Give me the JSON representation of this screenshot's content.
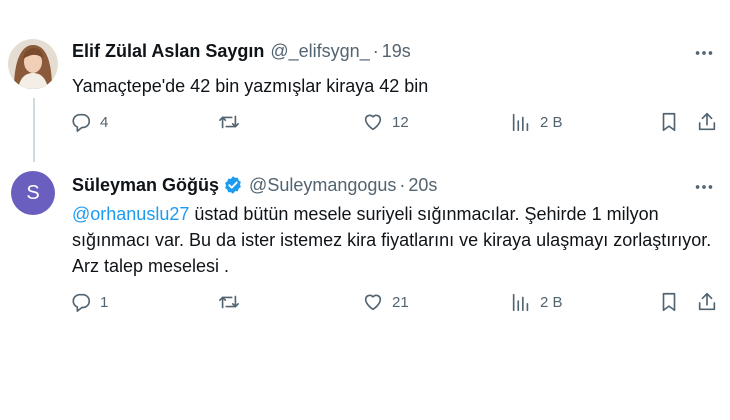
{
  "tweets": [
    {
      "display_name": "Elif Zülal Aslan Saygın",
      "handle": "@_elifsygn_",
      "separator": "·",
      "time": "19s",
      "avatar_icon": "user-photo",
      "text": "Yamaçtepe'de 42 bin yazmışlar kiraya 42 bin",
      "actions": {
        "replies": "4",
        "retweets": "",
        "likes": "12",
        "views": "2 B"
      }
    },
    {
      "display_name": "Süleyman Göğüş",
      "handle": "@Suleymangogus",
      "separator": "·",
      "time": "20s",
      "verified": true,
      "avatar_letter": "S",
      "mention": "@orhanuslu27",
      "text": " üstad bütün mesele suriyeli sığınmacılar.  Şehirde 1 milyon sığınmacı var. Bu da ister istemez kira fiyatlarını ve kiraya ulaşmayı zorlaştırıyor.  Arz talep meselesi .",
      "actions": {
        "replies": "1",
        "retweets": "",
        "likes": "21",
        "views": "2 B"
      }
    }
  ],
  "colors": {
    "accent": "#1d9bf0",
    "secondary_text": "#536471",
    "primary_text": "#0f1419",
    "avatar_bg": "#6a5fbf",
    "thread_line": "#cfd9de"
  }
}
